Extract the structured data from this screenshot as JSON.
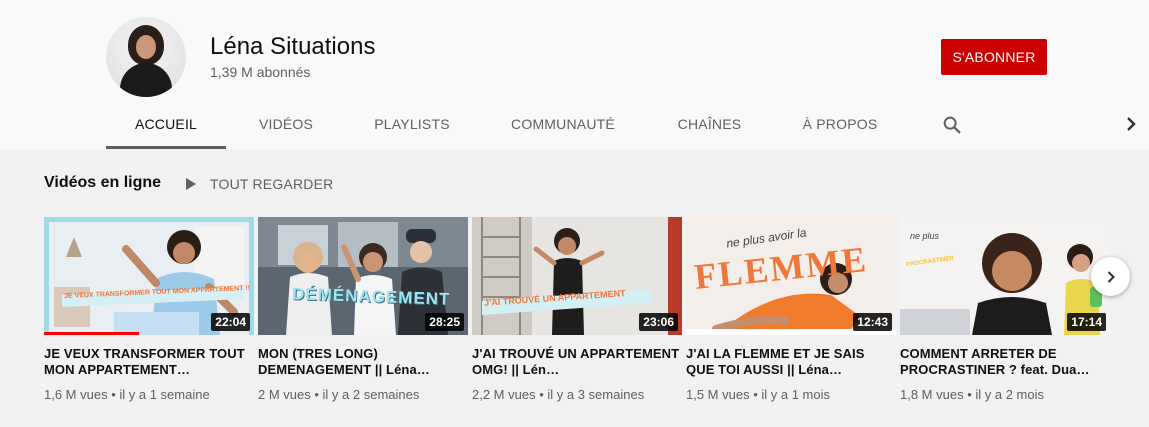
{
  "channel": {
    "name": "Léna Situations",
    "subscribers": "1,39 M abonnés",
    "subscribe_label": "S'ABONNER"
  },
  "tabs": [
    {
      "label": "ACCUEIL",
      "active": true
    },
    {
      "label": "VIDÉOS"
    },
    {
      "label": "PLAYLISTS"
    },
    {
      "label": "COMMUNAUTÉ"
    },
    {
      "label": "CHAÎNES"
    },
    {
      "label": "À PROPOS"
    }
  ],
  "tab_icons": {
    "search": "search-icon",
    "next": "chevron-right-icon"
  },
  "shelf": {
    "title": "Vidéos en ligne",
    "play_all_label": "TOUT REGARDER",
    "videos": [
      {
        "title": "JE VEUX TRANSFORMER TOUT MON APPARTEMENT…",
        "views": "1,6 M vues",
        "age": "il y a 1 semaine",
        "duration": "22:04",
        "watched_fraction": 0.45,
        "thumb_text": "JE VEUX TRANSFORMER TOUT MON APPARTEMENT !!"
      },
      {
        "title": "MON (TRES LONG) DEMENAGEMENT || Léna…",
        "views": "2 M vues",
        "age": "il y a 2 semaines",
        "duration": "28:25",
        "thumb_text": "DÉMÉNAGEMENT"
      },
      {
        "title": "J'AI TROUVÉ UN APPARTEMENT OMG! || Lén…",
        "views": "2,2 M vues",
        "age": "il y a 3 semaines",
        "duration": "23:06",
        "thumb_text": "J'AI TROUVÉ UN APPARTEMENT"
      },
      {
        "title": "J'AI LA FLEMME ET JE SAIS QUE TOI AUSSI || Léna…",
        "views": "1,5 M vues",
        "age": "il y a 1 mois",
        "duration": "12:43",
        "thumb_text": "FLEMME",
        "thumb_script": "ne plus avoir la"
      },
      {
        "title": "COMMENT ARRETER DE PROCRASTINER ? feat. Dua…",
        "views": "1,8 M vues",
        "age": "il y a 2 mois",
        "duration": "17:14",
        "thumb_script": "ne plus",
        "thumb_text": "PROCRASTINER"
      }
    ]
  },
  "colors": {
    "subscribe": "#cc0000",
    "header_bg": "#f9f9f9",
    "page_bg": "#f1f1f1",
    "progress": "#ff0000",
    "accent_orange": "#f0763a",
    "accent_cyan": "#6fd6e6"
  }
}
